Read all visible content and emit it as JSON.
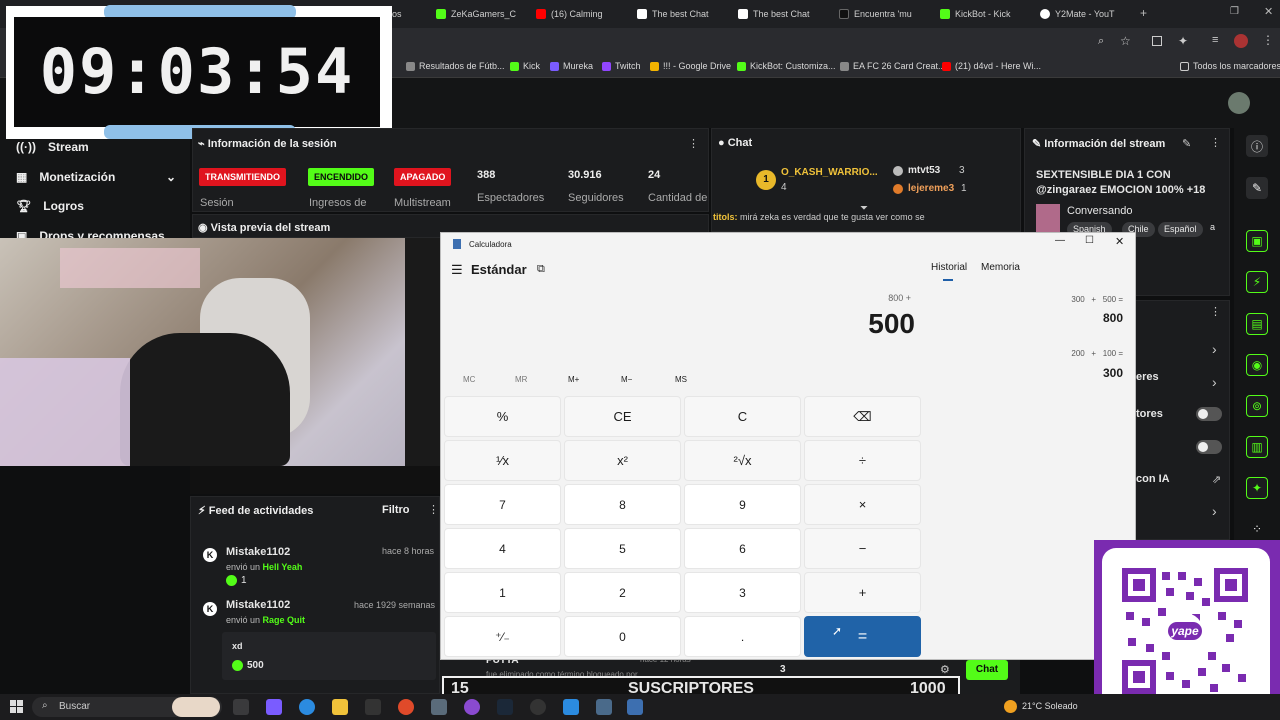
{
  "browser": {
    "tabs": [
      {
        "label": "os",
        "color": "#5a5a5a"
      },
      {
        "label": "ZeKaGamers_C",
        "color": "#53fc18"
      },
      {
        "label": "(16) Calming",
        "color": "#ff0000"
      },
      {
        "label": "The best Chat",
        "color": "#ffffff"
      },
      {
        "label": "The best Chat",
        "color": "#ffffff"
      },
      {
        "label": "Encuentra 'mu",
        "color": "#111111"
      },
      {
        "label": "KickBot - Kick",
        "color": "#53fc18"
      },
      {
        "label": "Y2Mate - YouT",
        "color": "#ffffff"
      }
    ],
    "url": "dashboard.kick.com/stream",
    "bookmarks": [
      {
        "label": "Resultados de Fútb...",
        "color": "#888"
      },
      {
        "label": "Kick",
        "color": "#53fc18"
      },
      {
        "label": "Mureka",
        "color": "#7a5cff"
      },
      {
        "label": "Twitch",
        "color": "#9146ff"
      },
      {
        "label": "!!! - Google Drive",
        "color": "#f4b400"
      },
      {
        "label": "KickBot: Customiza...",
        "color": "#53fc18"
      },
      {
        "label": "EA FC 26 Card Creat...",
        "color": "#888"
      },
      {
        "label": "(21) d4vd - Here Wi...",
        "color": "#ff0000"
      }
    ],
    "all_bookmarks": "Todos los marcadores"
  },
  "timer": {
    "value": "09:03:54"
  },
  "sidebar": {
    "items": [
      {
        "label": "Stream"
      },
      {
        "label": "Monetización"
      },
      {
        "label": "Logros"
      },
      {
        "label": "Drops y recompensas"
      }
    ]
  },
  "session": {
    "title": "Información de la sesión",
    "badges": [
      {
        "label": "TRANSMITIENDO",
        "bg": "#e0141e",
        "fg": "#ffffff"
      },
      {
        "label": "ENCENDIDO",
        "bg": "#53fc18",
        "fg": "#0b0b0b"
      },
      {
        "label": "APAGADO",
        "bg": "#e0141e",
        "fg": "#ffffff"
      }
    ],
    "badge_labels": [
      "Sesión",
      "Ingresos de",
      "Multistream"
    ],
    "stats": [
      {
        "value": "388",
        "label": "Espectadores"
      },
      {
        "value": "30.916",
        "label": "Seguidores"
      },
      {
        "value": "24",
        "label": "Cantidad de"
      }
    ]
  },
  "preview": {
    "title": "Vista previa del stream"
  },
  "chat": {
    "title": "Chat",
    "top_user": "O_KASH_WARRIO...",
    "top_rank": "1",
    "top_count": "4",
    "users": [
      {
        "name": "mtvt53",
        "count": "3"
      },
      {
        "name": "lejereme3",
        "count": "1"
      }
    ],
    "message_user": "titols:",
    "message": "mirá zeka es verdad que te gusta ver como se",
    "bottom_count": "3",
    "chat_button": "Chat",
    "footer_user": "PUTTA",
    "footer_time": "hace 12 horas",
    "footer_text": "fue eliminado como término bloqueado por"
  },
  "info": {
    "title": "Información del stream",
    "stream_title": "SEXTENSIBLE DIA 1 CON @zingaraez EMOCION 100% +18",
    "category": "Conversando",
    "tags": [
      "Spanish",
      "Chile",
      "Español",
      "a"
    ],
    "partial_rows": [
      "eres",
      "tores",
      "con IA"
    ]
  },
  "feed": {
    "title": "Feed de actividades",
    "filter": "Filtro",
    "items": [
      {
        "user": "Mistake1102",
        "time": "hace 8 horas",
        "action": "envió un",
        "item": "Hell Yeah",
        "amount": "1"
      },
      {
        "user": "Mistake1102",
        "time": "hace 1929 semanas",
        "action": "envió un",
        "item": "Rage Quit",
        "note": "xd",
        "amount": "500"
      }
    ]
  },
  "calculator": {
    "window_title": "Calculadora",
    "mode": "Estándar",
    "tabs": [
      "Historial",
      "Memoria"
    ],
    "expression": "800 +",
    "display": "500",
    "memory_buttons": [
      "MC",
      "MR",
      "M+",
      "M−",
      "MS"
    ],
    "keys": [
      [
        "%",
        "CE",
        "C",
        "⌫"
      ],
      [
        "¹⁄x",
        "x²",
        "²√x",
        "÷"
      ],
      [
        "7",
        "8",
        "9",
        "×"
      ],
      [
        "4",
        "5",
        "6",
        "−"
      ],
      [
        "1",
        "2",
        "3",
        "+"
      ],
      [
        "⁺⁄₋",
        "0",
        ".",
        "="
      ]
    ],
    "history": [
      {
        "expr": "300   +   500 =",
        "result": "800"
      },
      {
        "expr": "200   +   100 =",
        "result": "300"
      }
    ]
  },
  "subs_bar": {
    "count": "15",
    "label": "SUSCRIPTORES",
    "goal": "1000"
  },
  "qr": {
    "brand": "yape"
  },
  "taskbar": {
    "search": "Buscar",
    "weather": "21°C  Soleado"
  }
}
